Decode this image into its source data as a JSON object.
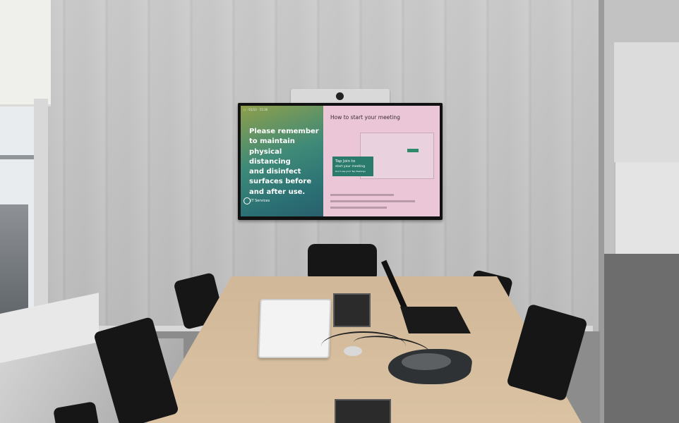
{
  "scene": {
    "description_label": "",
    "screen": {
      "status_bar": "○ · 01/12 · 15:30",
      "left_panel": {
        "message_lines": [
          "Please remember",
          "to maintain",
          "physical distancing",
          "and disinfect",
          "surfaces before",
          "and after use."
        ],
        "brand": "IT Services"
      },
      "right_panel": {
        "heading": "How to start your meeting",
        "callout_line1": "Tap Join to",
        "callout_line2": "start your meeting",
        "callout_line3": "Don't see Join? Tap Meetings"
      }
    }
  },
  "colors": {
    "wall": "#c4c4c4",
    "table": "#d8bf9e",
    "screen_left": "#2a6f74",
    "screen_right": "#ebc6d7",
    "callout": "#2a7b6c"
  }
}
